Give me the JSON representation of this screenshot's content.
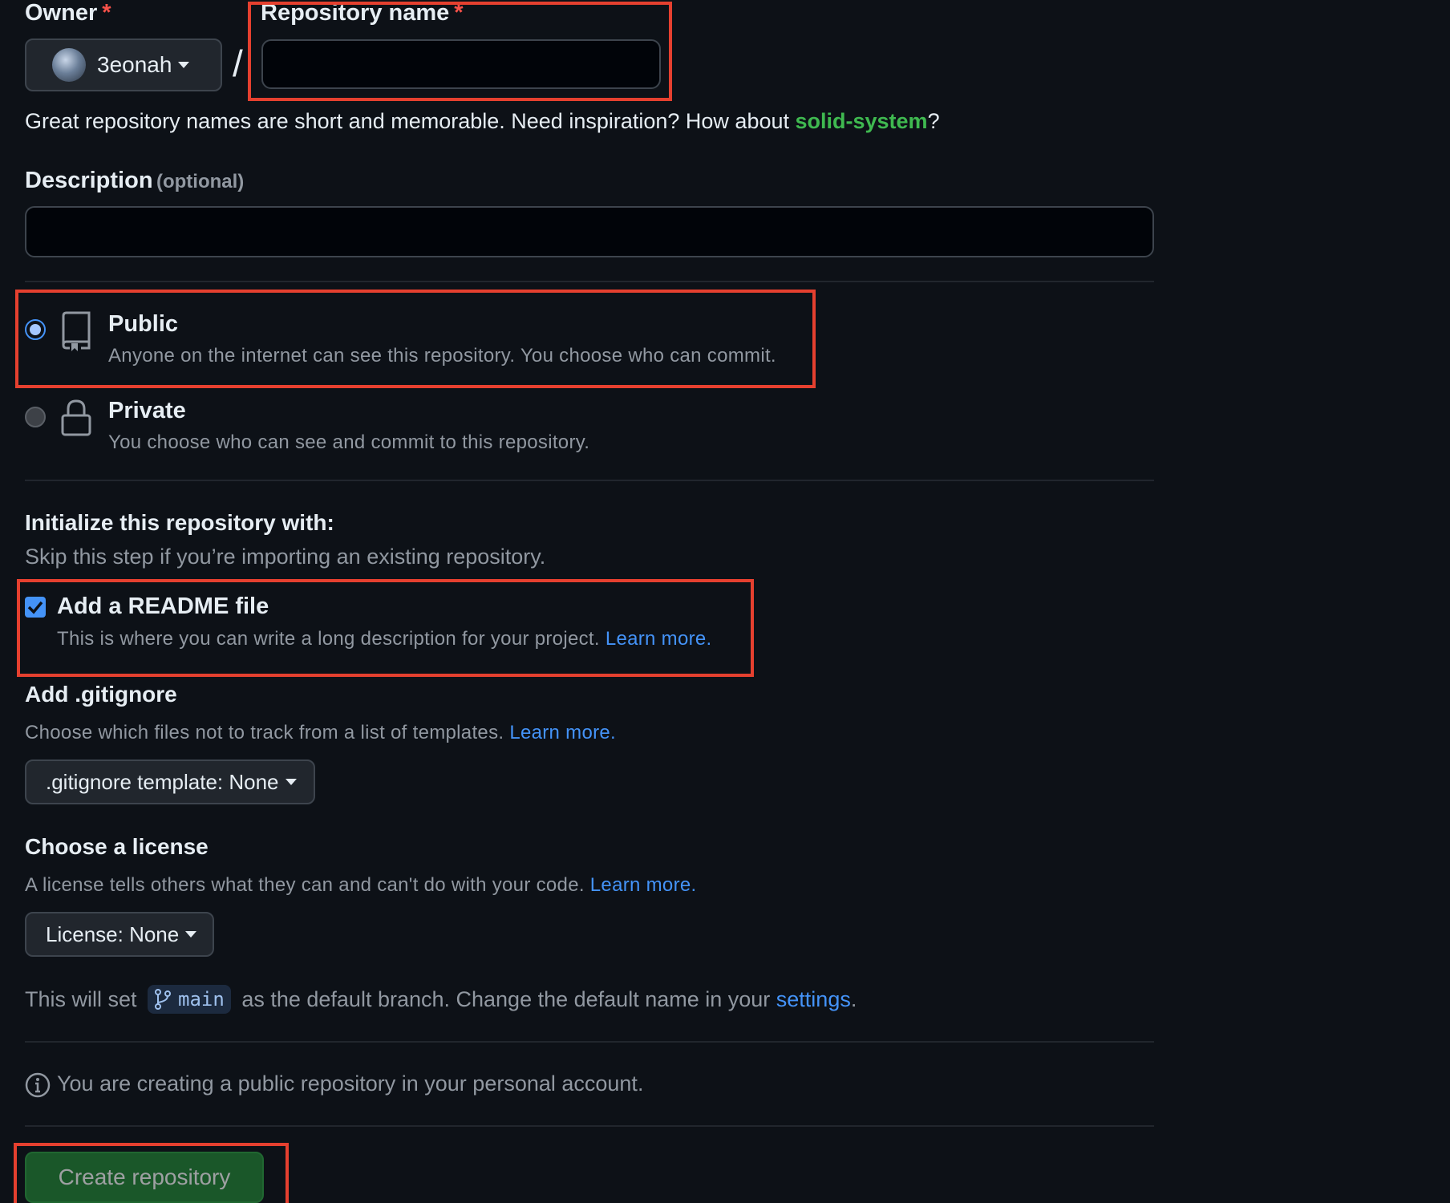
{
  "owner": {
    "label": "Owner",
    "required_mark": "*",
    "username": "3eonah"
  },
  "separator": "/",
  "repo_name": {
    "label": "Repository name",
    "required_mark": "*",
    "value": ""
  },
  "name_hint": {
    "prefix": "Great repository names are short and memorable. Need inspiration? How about ",
    "suggestion": "solid-system",
    "suffix": "?"
  },
  "description": {
    "label": "Description",
    "optional": "(optional)",
    "value": ""
  },
  "visibility": {
    "public": {
      "title": "Public",
      "desc": "Anyone on the internet can see this repository. You choose who can commit.",
      "selected": true
    },
    "private": {
      "title": "Private",
      "desc": "You choose who can see and commit to this repository.",
      "selected": false
    }
  },
  "init": {
    "title": "Initialize this repository with:",
    "subtitle": "Skip this step if you’re importing an existing repository.",
    "readme": {
      "title": "Add a README file",
      "desc": "This is where you can write a long description for your project. ",
      "link": "Learn more.",
      "checked": true
    }
  },
  "gitignore": {
    "title": "Add .gitignore",
    "desc": "Choose which files not to track from a list of templates. ",
    "link": "Learn more.",
    "button": ".gitignore template: None"
  },
  "license": {
    "title": "Choose a license",
    "desc": "A license tells others what they can and can't do with your code. ",
    "link": "Learn more.",
    "button": "License: None"
  },
  "branch_note": {
    "prefix": "This will set ",
    "branch": "main",
    "middle": " as the default branch. Change the default name in your ",
    "link": "settings",
    "suffix": "."
  },
  "info_note": "You are creating a public repository in your personal account.",
  "create_button": "Create repository",
  "colors": {
    "background": "#0d1117",
    "highlight": "#e5402f",
    "link": "#4493f8",
    "suggestion": "#3fb950",
    "create_button": "#238636"
  }
}
